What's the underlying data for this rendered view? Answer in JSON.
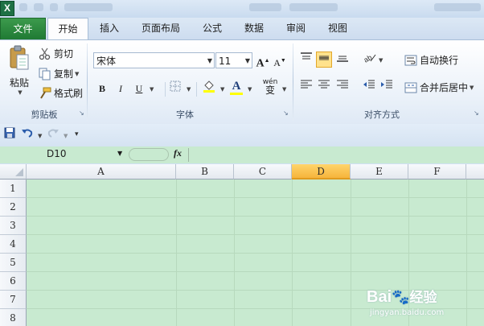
{
  "app": {
    "logo_letter": "X"
  },
  "tabs": [
    {
      "label": "文件"
    },
    {
      "label": "开始"
    },
    {
      "label": "插入"
    },
    {
      "label": "页面布局"
    },
    {
      "label": "公式"
    },
    {
      "label": "数据"
    },
    {
      "label": "审阅"
    },
    {
      "label": "视图"
    }
  ],
  "clipboard": {
    "paste": "粘贴",
    "cut": "剪切",
    "copy": "复制",
    "format_painter": "格式刷",
    "group": "剪贴板"
  },
  "font": {
    "name": "宋体",
    "size": "11",
    "bold": "B",
    "italic": "I",
    "underline": "U",
    "font_color_letter": "A",
    "pinyin": "wén",
    "group": "字体",
    "grow": "A",
    "shrink": "A"
  },
  "alignment": {
    "wrap_text": "自动换行",
    "merge_center": "合并后居中",
    "group": "对齐方式"
  },
  "formula_bar": {
    "name_box": "D10",
    "fx": "fx"
  },
  "grid": {
    "columns": [
      "A",
      "B",
      "C",
      "D",
      "E",
      "F"
    ],
    "selected_column": "D",
    "rows": [
      "1",
      "2",
      "3",
      "4",
      "5",
      "6",
      "7",
      "8"
    ]
  },
  "watermark": {
    "brand": "Bai",
    "brand2": "经验",
    "url": "jingyan.baidu.com"
  },
  "colors": {
    "file_tab": "#1f7a34",
    "selected_header": "#f6b43c",
    "cell_bg": "#c8ead0",
    "font_color_bar": "#ffff00"
  }
}
